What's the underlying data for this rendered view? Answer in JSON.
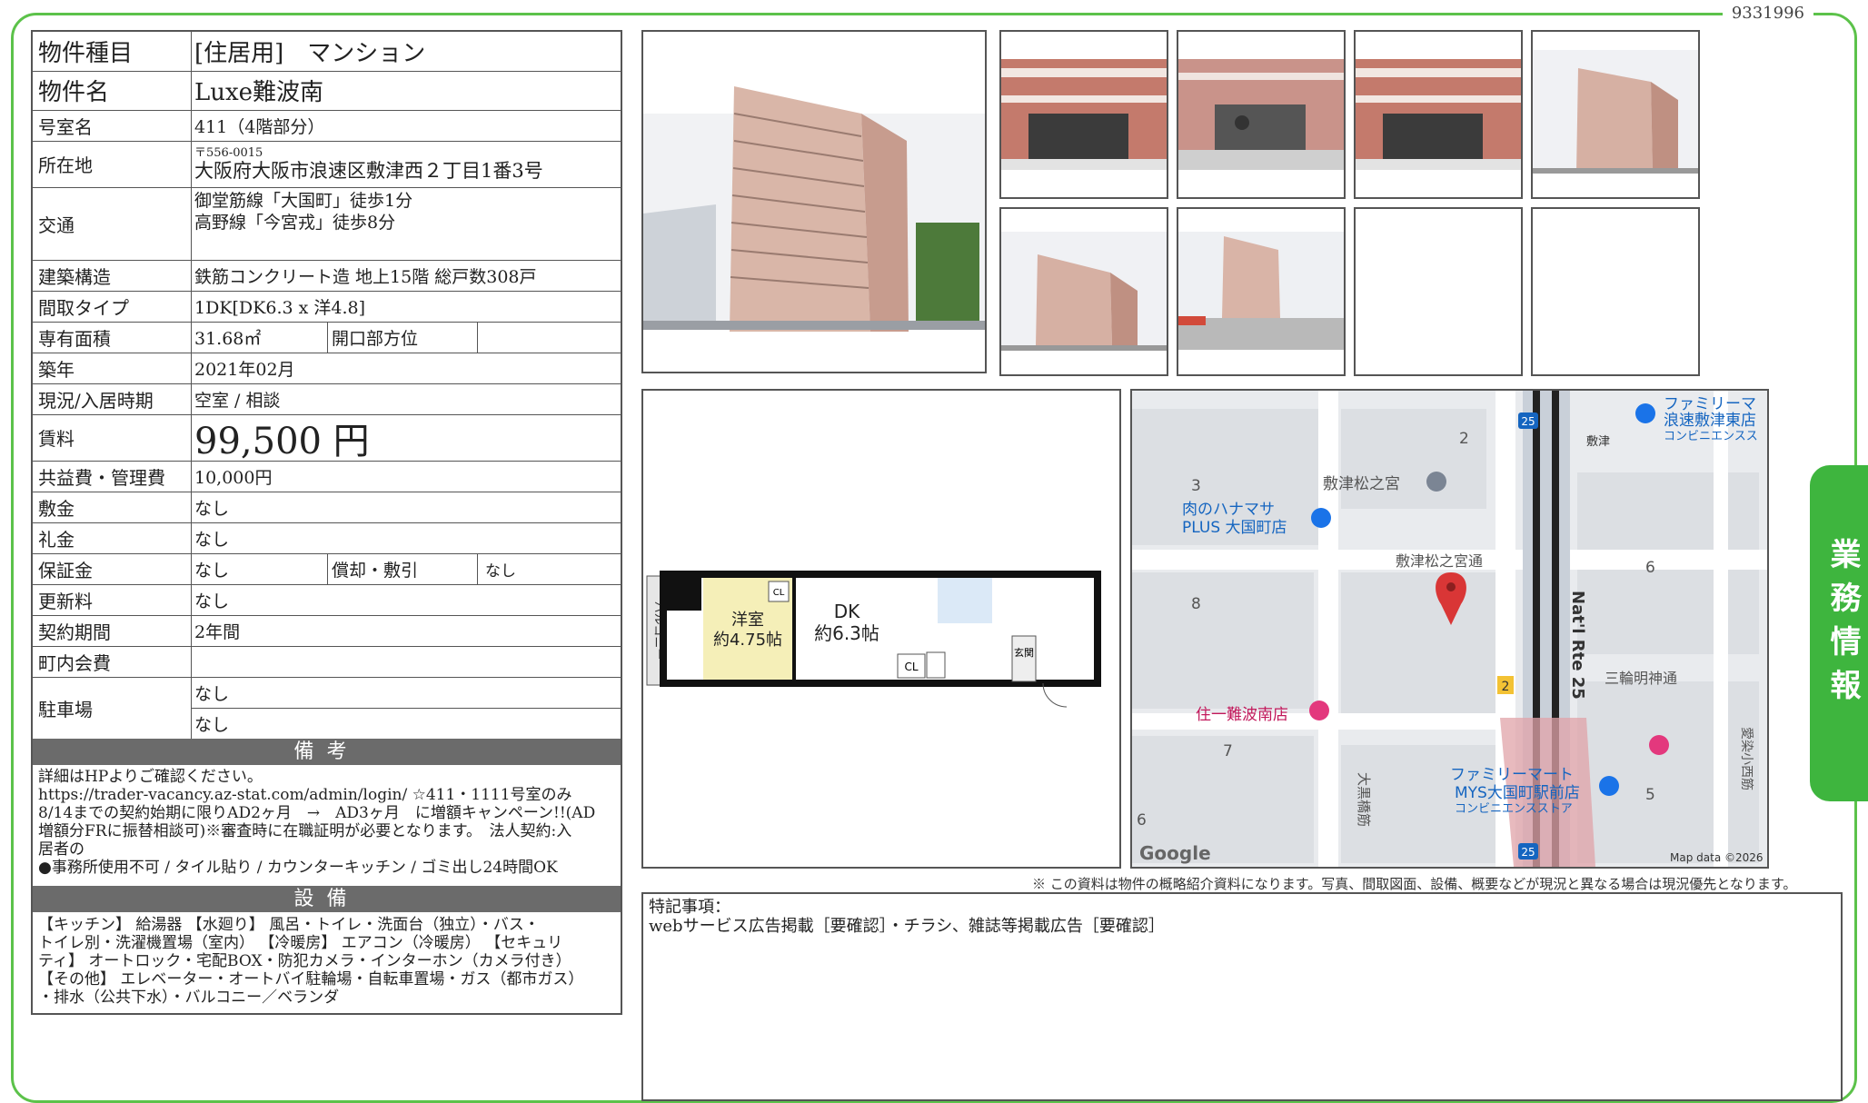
{
  "doc_id": "9331996",
  "side_tab": "業務情報",
  "rows": {
    "type": {
      "label": "物件種目",
      "value": "[住居用]　マンション"
    },
    "name": {
      "label": "物件名",
      "value": "Luxe難波南"
    },
    "room": {
      "label": "号室名",
      "value": "411（4階部分）"
    },
    "address": {
      "label": "所在地",
      "zip": "〒556-0015",
      "value": "大阪府大阪市浪速区敷津西２丁目1番3号"
    },
    "access": {
      "label": "交通",
      "line1": "御堂筋線「大国町」徒歩1分",
      "line2": "高野線「今宮戎」徒歩8分"
    },
    "structure": {
      "label": "建築構造",
      "value": "鉄筋コンクリート造 地上15階 総戸数308戸"
    },
    "layout": {
      "label": "間取タイプ",
      "value": "1DK[DK6.3 x 洋4.8]"
    },
    "area": {
      "label": "専有面積",
      "value": "31.68㎡",
      "sub_label": "開口部方位",
      "sub_value": ""
    },
    "built": {
      "label": "築年",
      "value": "2021年02月"
    },
    "status": {
      "label": "現況/入居時期",
      "value": "空室 / 相談"
    },
    "rent": {
      "label": "賃料",
      "value": "99,500 円"
    },
    "fee": {
      "label": "共益費・管理費",
      "value": "10,000円"
    },
    "deposit": {
      "label": "敷金",
      "value": "なし"
    },
    "key_money": {
      "label": "礼金",
      "value": "なし"
    },
    "guarantee": {
      "label": "保証金",
      "value": "なし",
      "sub_label": "償却・敷引",
      "sub_value": "なし"
    },
    "renewal": {
      "label": "更新料",
      "value": "なし"
    },
    "contract": {
      "label": "契約期間",
      "value": "2年間"
    },
    "community": {
      "label": "町内会費",
      "value": ""
    },
    "parking": {
      "label": "駐車場",
      "value1": "なし",
      "value2": "なし"
    }
  },
  "remarks_section": {
    "title": "備考",
    "lines": [
      "詳細はHPよりご確認ください。",
      "https://trader-vacancy.az-stat.com/admin/login/ ☆411・1111号室のみ",
      "8/14までの契約始期に限りAD2ヶ月　→　AD3ヶ月　に増額キャンペーン!!(AD",
      "増額分FRに振替相談可)※審査時に在職証明が必要となります。　法人契約:入",
      "居者の",
      "●事務所使用不可 / タイル貼り / カウンターキッチン / ゴミ出し24時間OK"
    ]
  },
  "equipment_section": {
    "title": "設備",
    "lines": [
      "【キッチン】 給湯器 【水廻り】 風呂・トイレ・洗面台（独立）・バス・",
      "トイレ別・洗濯機置場（室内） 【冷暖房】 エアコン（冷暖房） 【セキュリ",
      "ティ】 オートロック・宅配BOX・防犯カメラ・インターホン（カメラ付き）",
      "【その他】 エレベーター・オートバイ駐輪場・自転車置場・ガス（都市ガス）",
      "・排水（公共下水）・バルコニー／ベランダ"
    ]
  },
  "floorplan": {
    "room1": "洋室",
    "room1_size": "約4.75帖",
    "room2": "DK",
    "room2_size": "約6.3帖",
    "balcony": "バルコニー",
    "cl": "CL",
    "entrance": "玄関"
  },
  "map": {
    "labels": {
      "familymart1_l1": "ファミリーマ",
      "familymart1_l2": "浪速敷津東店",
      "familymart1_l3": "コンビニエンスス",
      "shrine": "敷津松之宮",
      "meat_l1": "肉のハナマサ",
      "meat_l2": "PLUS 大国町店",
      "street1": "敷津松之宮通",
      "route": "Nat'l Rte 25",
      "street2": "三輪明神通",
      "hotel": "住一難波南店",
      "familymart2_l1": "ファミリーマート",
      "familymart2_l2": "MYS大国町駅前店",
      "familymart2_l3": "コンビニエンスストア",
      "street3": "大黒橋筋",
      "street4": "愛染小西筋",
      "shikitsu": "敷津",
      "n2": "2",
      "n3": "3",
      "n8": "8",
      "n6": "6",
      "n7": "7",
      "n6b": "6",
      "n5": "5",
      "shield25a": "25",
      "shield25b": "25",
      "exit2": "2",
      "google": "Google",
      "mapdata": "Map data ©2026"
    }
  },
  "disclaimer": "※ この資料は物件の概略紹介資料になります。写真、間取図面、設備、概要などが現況と異なる場合は現況優先となります。",
  "special_notes": {
    "title": "特記事項：",
    "text": "webサービス広告掲載［要確認］・チラシ、雑誌等掲載広告［要確認］"
  },
  "colors": {
    "frame": "#5cc24a",
    "tab": "#3eb53e",
    "section_header": "#6b6b6b",
    "route": "#e0a3a8",
    "pin": "#d93636"
  }
}
